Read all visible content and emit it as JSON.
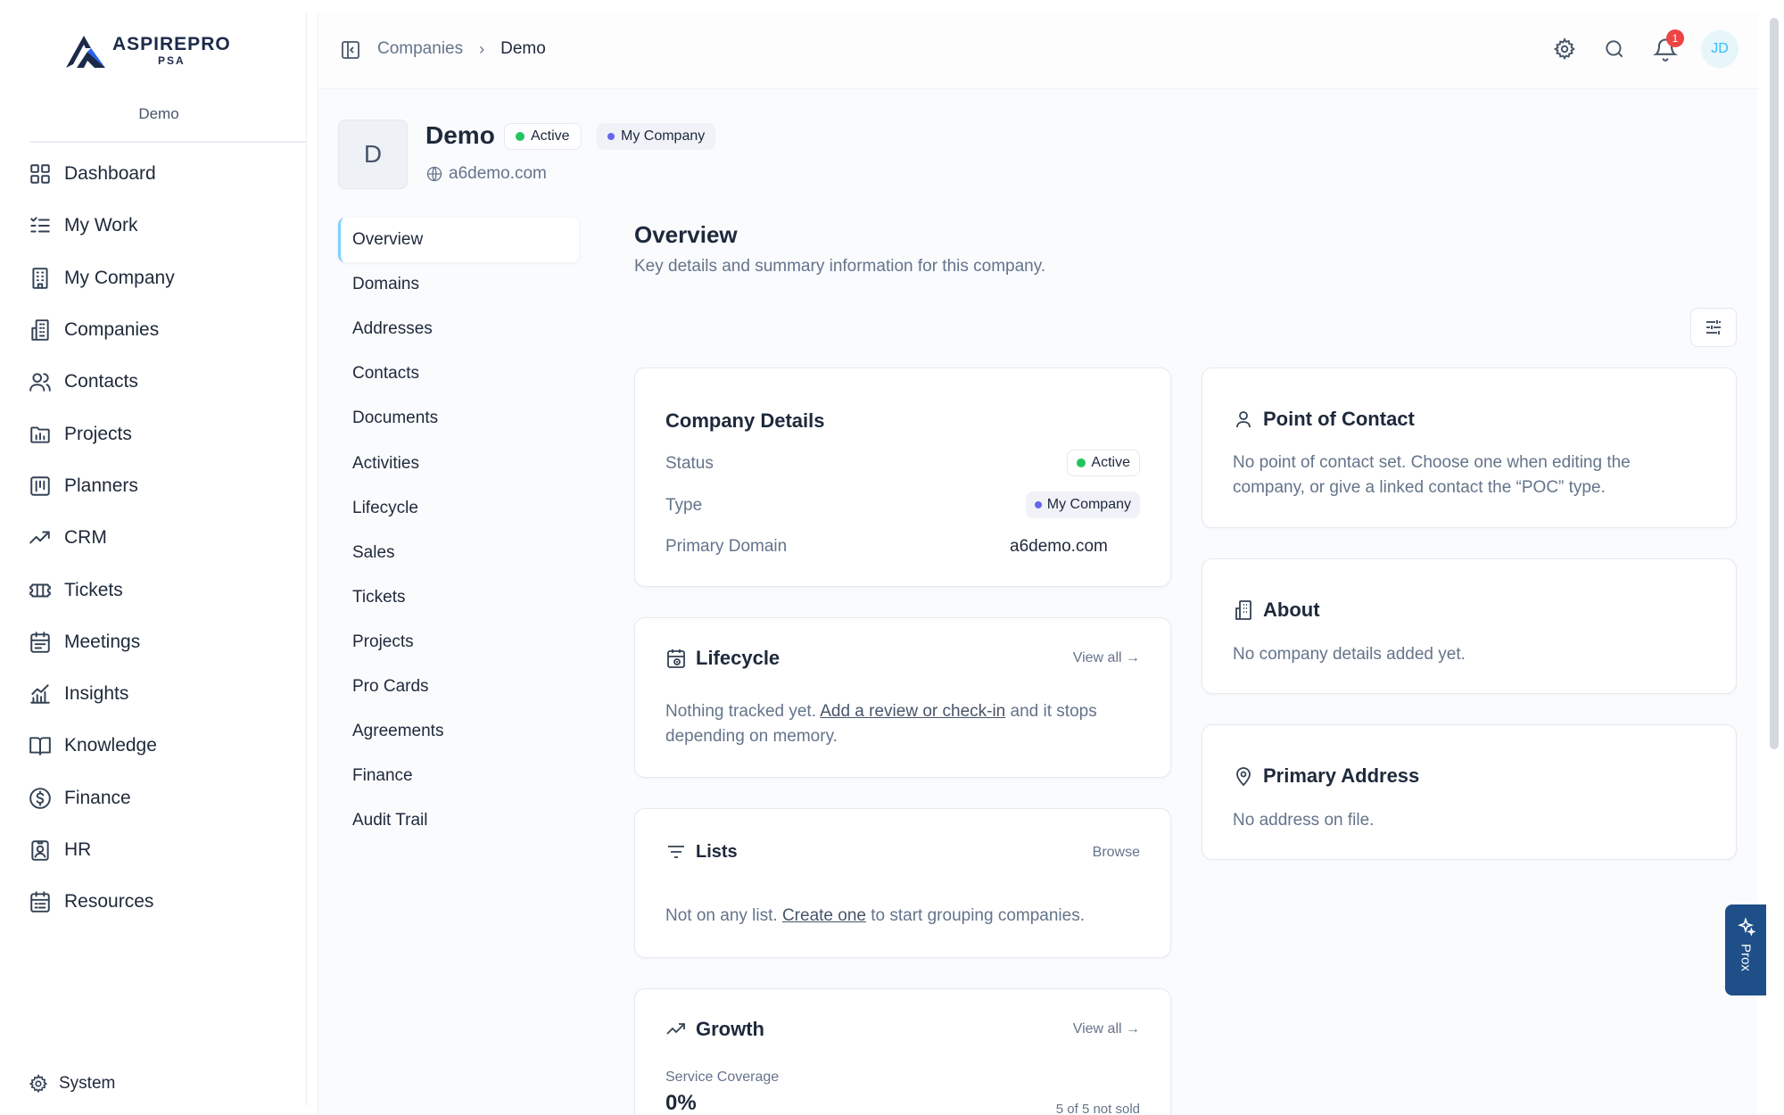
{
  "brand": {
    "name": "ASPIREPRO",
    "sub": "PSA",
    "workspace": "Demo"
  },
  "sidebar": {
    "items": [
      {
        "label": "Dashboard",
        "icon": "dashboard-icon"
      },
      {
        "label": "My Work",
        "icon": "checklist-icon"
      },
      {
        "label": "My Company",
        "icon": "building-icon"
      },
      {
        "label": "Companies",
        "icon": "buildings-icon"
      },
      {
        "label": "Contacts",
        "icon": "users-icon"
      },
      {
        "label": "Projects",
        "icon": "folder-chart-icon"
      },
      {
        "label": "Planners",
        "icon": "kanban-icon"
      },
      {
        "label": "CRM",
        "icon": "trend-up-icon"
      },
      {
        "label": "Tickets",
        "icon": "ticket-icon"
      },
      {
        "label": "Meetings",
        "icon": "calendar-icon"
      },
      {
        "label": "Insights",
        "icon": "bar-chart-icon"
      },
      {
        "label": "Knowledge",
        "icon": "book-icon"
      },
      {
        "label": "Finance",
        "icon": "dollar-icon"
      },
      {
        "label": "HR",
        "icon": "id-badge-icon"
      },
      {
        "label": "Resources",
        "icon": "calendar-list-icon"
      }
    ],
    "system_label": "System"
  },
  "topbar": {
    "breadcrumb": {
      "parent": "Companies",
      "separator": "›",
      "current": "Demo"
    },
    "notification_count": "1",
    "avatar_initials": "JD"
  },
  "company": {
    "initial": "D",
    "name": "Demo",
    "status": "Active",
    "type": "My Company",
    "domain": "a6demo.com"
  },
  "subnav": {
    "items": [
      "Overview",
      "Domains",
      "Addresses",
      "Contacts",
      "Documents",
      "Activities",
      "Lifecycle",
      "Sales",
      "Tickets",
      "Projects",
      "Pro Cards",
      "Agreements",
      "Finance",
      "Audit Trail"
    ]
  },
  "overview": {
    "title": "Overview",
    "subtitle": "Key details and summary information for this company."
  },
  "company_details": {
    "title": "Company Details",
    "status_label": "Status",
    "status_value": "Active",
    "type_label": "Type",
    "type_value": "My Company",
    "domain_label": "Primary Domain",
    "domain_value": "a6demo.com"
  },
  "lifecycle": {
    "title": "Lifecycle",
    "link": "View all →",
    "text_before": "Nothing tracked yet. ",
    "text_link": "Add a review or check-in",
    "text_after": " and it stops depending on memory."
  },
  "lists": {
    "title": "Lists",
    "link": "Browse",
    "text_before": "Not on any list. ",
    "text_link": "Create one",
    "text_after": " to start grouping companies."
  },
  "growth": {
    "title": "Growth",
    "link": "View all →",
    "metric_label": "Service Coverage",
    "metric_value": "0%",
    "metric_note": "5 of 5 not sold"
  },
  "poc": {
    "title": "Point of Contact",
    "text": "No point of contact set. Choose one when editing the company, or give a linked contact the “POC” type."
  },
  "about": {
    "title": "About",
    "text": "No company details added yet."
  },
  "address": {
    "title": "Primary Address",
    "text": "No address on file."
  },
  "prox": {
    "label": "Prox"
  },
  "colors": {
    "accent": "#1e4f88",
    "active_dot": "#22c55e",
    "type_dot": "#6366f1",
    "badge": "#ef4444",
    "active_tab_border": "#7dd3fc"
  }
}
